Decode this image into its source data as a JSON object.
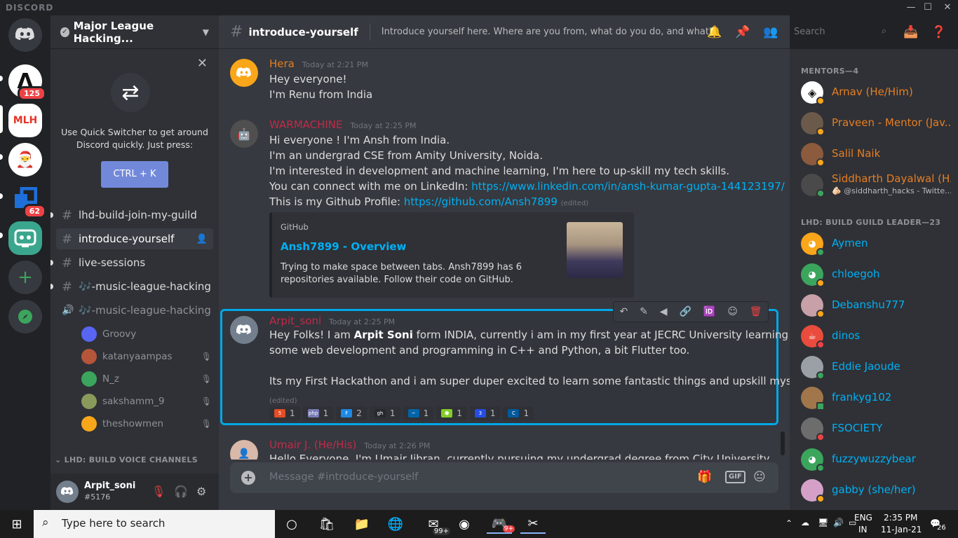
{
  "window": {
    "brand": "DISCORD",
    "minimize": "—",
    "maximize": "☐",
    "close": "✕"
  },
  "servers": [
    {
      "name": "home",
      "badge": ""
    },
    {
      "name": "A",
      "badge": "125"
    },
    {
      "name": "MLH",
      "badge": ""
    },
    {
      "name": "build",
      "badge": ""
    },
    {
      "name": "blue",
      "badge": "62"
    },
    {
      "name": "bot",
      "badge": ""
    }
  ],
  "guild": {
    "name": "Major League Hacking..."
  },
  "quick_switcher": {
    "text": "Use Quick Switcher to get around Discord quickly. Just press:",
    "button": "CTRL + K"
  },
  "channels": [
    {
      "name": "lhd-build-join-my-guild",
      "type": "text"
    },
    {
      "name": "introduce-yourself",
      "type": "text"
    },
    {
      "name": "live-sessions",
      "type": "text"
    },
    {
      "name": "🎶-music-league-hacking",
      "type": "text"
    },
    {
      "name": "🎶-music-league-hacking",
      "type": "voice"
    }
  ],
  "voice_users": [
    "Groovy",
    "katanyaampas",
    "N_z",
    "sakshamm_9",
    "theshowmen"
  ],
  "voice_category": "LHD: BUILD VOICE CHANNELS",
  "user": {
    "name": "Arpit_soni",
    "tag": "#5176"
  },
  "chat": {
    "channel": "introduce-yourself",
    "topic": "Introduce yourself here. Where are you from, what do you do, and what's your f...",
    "search_placeholder": "Search",
    "composer_placeholder": "Message #introduce-yourself",
    "gif_label": "GIF"
  },
  "messages": [
    {
      "author": "Hera",
      "color": "#e67e22",
      "time": "Today at 2:21 PM",
      "lines": [
        "Hey everyone!",
        "I'm Renu from India"
      ]
    },
    {
      "author": "WARMACHINE",
      "color": "#c22a4a",
      "time": "Today at 2:25 PM",
      "lines": [
        "Hi everyone ! I'm Ansh from India.",
        "I'm an undergrad CSE from Amity University, Noida.",
        "I'm interested in development and machine learning, I'm here to up-skill my tech skills.",
        "You can connect with me on LinkedIn: ",
        "This is my Github Profile: "
      ],
      "linkedin": "https://www.linkedin.com/in/ansh-kumar-gupta-144123197/",
      "github": "https://github.com/Ansh7899",
      "edited": "(edited)",
      "embed": {
        "provider": "GitHub",
        "title": "Ansh7899 - Overview",
        "description": "Trying to make space between tabs. Ansh7899 has 6 repositories available. Follow their code on GitHub."
      }
    },
    {
      "author": "Arpit_soni",
      "color": "#c22a4a",
      "time": "Today at 2:25 PM",
      "line1_pre": "Hey Folks! I am ",
      "line1_bold": "Arpit Soni",
      "line1_post": " form INDIA, currently i am in my first year at JECRC University learning",
      "line2": "some web development and programming in C++ and Python, a bit Flutter too.",
      "line3": "Its my First Hackathon and i am super duper excited to learn some fantastic things and upskill myself.",
      "edited": "(edited)",
      "reactions": [
        {
          "emoji": "html",
          "count": "1",
          "color": "#e44d26"
        },
        {
          "emoji": "php",
          "count": "1",
          "color": "#777bb4"
        },
        {
          "emoji": "flutter",
          "count": "2",
          "color": "#1e88e5"
        },
        {
          "emoji": "github",
          "count": "1",
          "color": "#24292e"
        },
        {
          "emoji": "vscode",
          "count": "1",
          "color": "#0065a9"
        },
        {
          "emoji": "node",
          "count": "1",
          "color": "#83cd29"
        },
        {
          "emoji": "css",
          "count": "1",
          "color": "#264de4"
        },
        {
          "emoji": "cpp",
          "count": "1",
          "color": "#00599c"
        }
      ]
    },
    {
      "author": "Umair J. (He/His)",
      "color": "#c22a4a",
      "time": "Today at 2:26 PM",
      "lines": [
        "Hello Everyone, I'm Umair Jibran, currently pursuing my undergrad degree from City University,"
      ]
    }
  ],
  "members": {
    "cat1": "MENTORS—4",
    "mentors": [
      {
        "name": "Arnav (He/Him)",
        "color": "#e67e22",
        "activity": "",
        "status": "#faa61a"
      },
      {
        "name": "Praveen - Mentor (Jav...",
        "color": "#e67e22",
        "activity": "",
        "status": "#faa61a"
      },
      {
        "name": "Salil Naik",
        "color": "#e67e22",
        "activity": "",
        "status": "#faa61a"
      },
      {
        "name": "Siddharth Dayalwal (H...",
        "color": "#e67e22",
        "activity": "🫵🏻 @siddharth_hacks - Twitte...",
        "status": "#3ba55d"
      }
    ],
    "cat2": "LHD: BUILD GUILD LEADER—23",
    "leaders": [
      {
        "name": "Aymen",
        "color": "#00b0f4",
        "status": "#3ba55d"
      },
      {
        "name": "chloegoh",
        "color": "#00b0f4",
        "status": "#faa61a"
      },
      {
        "name": "Debanshu777",
        "color": "#00b0f4",
        "status": "#faa61a"
      },
      {
        "name": "dinos",
        "color": "#00b0f4",
        "status": "#ed4245"
      },
      {
        "name": "Eddie Jaoude",
        "color": "#00b0f4",
        "status": "#3ba55d"
      },
      {
        "name": "frankyg102",
        "color": "#00b0f4",
        "status": "#3ba55d"
      },
      {
        "name": "FSOCIETY",
        "color": "#00b0f4",
        "status": "#ed4245"
      },
      {
        "name": "fuzzywuzzybear",
        "color": "#00b0f4",
        "status": "#3ba55d"
      },
      {
        "name": "gabby (she/her)",
        "color": "#00b0f4",
        "status": "#faa61a"
      }
    ]
  },
  "taskbar": {
    "search_placeholder": "Type here to search",
    "mail_badge": "99+",
    "discord_badge": "9+",
    "lang1": "ENG",
    "lang2": "IN",
    "time": "2:35 PM",
    "date": "11-Jan-21",
    "notif": "26"
  }
}
